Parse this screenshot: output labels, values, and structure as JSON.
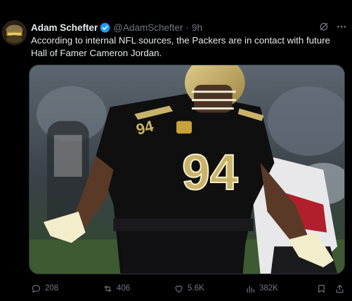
{
  "tweet": {
    "author_name": "Adam Schefter",
    "handle": "@AdamSchefter",
    "separator": "·",
    "time": "9h",
    "text": "According to internal NFL sources, the Packers are in contact with future Hall of Famer Cameron Jordan.",
    "media": {
      "jersey_number": "94",
      "description_colors": {
        "jersey": "#0f0f10",
        "gold": "#c9b26a",
        "field": "#3d5a33"
      }
    },
    "metrics": {
      "replies": "208",
      "reposts": "406",
      "likes": "5.6K",
      "views": "382K"
    }
  },
  "icons": {
    "verified": "verified-badge-icon",
    "grok": "grok-icon",
    "more": "more-icon",
    "reply": "reply-icon",
    "repost": "repost-icon",
    "like": "like-icon",
    "views": "views-icon",
    "bookmark": "bookmark-icon",
    "share": "share-icon"
  },
  "colors": {
    "background": "#000000",
    "text": "#e7e9ea",
    "muted": "#71767b",
    "verified": "#1d9bf0"
  }
}
